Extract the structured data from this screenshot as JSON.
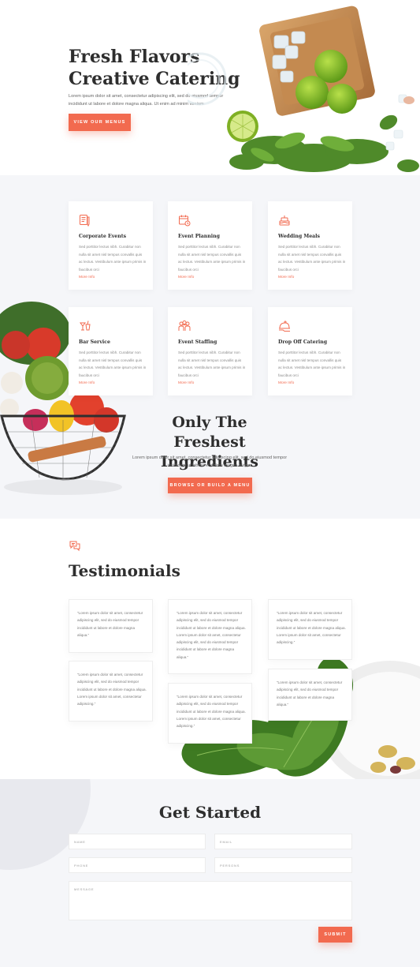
{
  "hero": {
    "title_line1": "Fresh Flavors",
    "title_line2": "Creative Catering",
    "text": "Lorem ipsum dolor sit amet, consectetur adipiscing elit, sed do eiusmod tempor incididunt ut labore et dolore magna aliqua. Ut enim ad minim veniam",
    "button": "VIEW OUR MENUS"
  },
  "services": {
    "items": [
      {
        "icon": "document-pencil-icon",
        "title": "Corporate Events",
        "body": "Sed porttitor lectus nibh. Curabitur non nulla sit amet nisl tempus convallis quis ac lectus. Vestibulum ante ipsum primis in faucibus orci",
        "more": "More Info"
      },
      {
        "icon": "calendar-icon",
        "title": "Event Planning",
        "body": "Sed porttitor lectus nibh. Curabitur non nulla sit amet nisl tempus convallis quis ac lectus. Vestibulum ante ipsum primis in faucibus orci",
        "more": "More Info"
      },
      {
        "icon": "cake-icon",
        "title": "Wedding Meals",
        "body": "Sed porttitor lectus nibh. Curabitur non nulla sit amet nisl tempus convallis quis ac lectus. Vestibulum ante ipsum primis in faucibus orci",
        "more": "More Info"
      },
      {
        "icon": "cocktail-icon",
        "title": "Bar Service",
        "body": "Sed porttitor lectus nibh. Curabitur non nulla sit amet nisl tempus convallis quis ac lectus. Vestibulum ante ipsum primis in faucibus orci",
        "more": "More Info"
      },
      {
        "icon": "staff-icon",
        "title": "Event Staffing",
        "body": "Sed porttitor lectus nibh. Curabitur non nulla sit amet nisl tempus convallis quis ac lectus. Vestibulum ante ipsum primis in faucibus orci",
        "more": "More Info"
      },
      {
        "icon": "cloche-icon",
        "title": "Drop Off Catering",
        "body": "Sed porttitor lectus nibh. Curabitur non nulla sit amet nisl tempus convallis quis ac lectus. Vestibulum ante ipsum primis in faucibus orci",
        "more": "More Info"
      }
    ]
  },
  "fresh": {
    "title_line1": "Only The Freshest",
    "title_line2": "Ingredients",
    "text": "Lorem ipsum dolor sit amet, consectetur adipiscing elit, sed do eiusmod tempor incididunt ut labore et dolore magna aliqua.",
    "button": "BROWSE OR BUILD A MENU"
  },
  "testimonials": {
    "title": "Testimonials",
    "items": [
      "“Lorem ipsum dolor sit amet, consectetur adipiscing elit, sed do eiusmod tempor incididunt ut labore et dolore magna aliqua.”",
      "“Lorem ipsum dolor sit amet, consectetur adipiscing elit, sed do eiusmod tempor incididunt ut labore et dolore magna aliqua. Lorem ipsum dolor sit amet, consectetur adipiscing.”",
      "“Lorem ipsum dolor sit amet, consectetur adipiscing elit, sed do eiusmod tempor incididunt ut labore et dolore magna aliqua. Lorem ipsum dolor sit amet, consectetur adipiscing elit, sed do eiusmod tempor incididunt ut labore et dolore magna aliqua.”",
      "“Lorem ipsum dolor sit amet, consectetur adipiscing elit, sed do eiusmod tempor incididunt ut labore et dolore magna aliqua.”",
      "“Lorem ipsum dolor sit amet, consectetur adipiscing elit, sed do eiusmod tempor incididunt ut labore et dolore magna aliqua. Lorem ipsum dolor sit amet, consectetur adipiscing.”",
      "“Lorem ipsum dolor sit amet, consectetur adipiscing elit, sed do eiusmod tempor incididunt ut labore et dolore magna aliqua. Lorem ipsum dolor sit amet, consectetur adipiscing.”",
      "“Lorem ipsum dolor sit amet, consectetur adipiscing elit, sed do eiusmod tempor incididunt ut labore et dolore magna aliqua.”"
    ]
  },
  "form": {
    "title": "Get Started",
    "name": "NAME",
    "email": "EMAIL",
    "phone": "PHONE",
    "persons": "PERSONS",
    "message": "MESSAGE",
    "submit": "SUBMIT"
  },
  "colors": {
    "accent": "#f26a4f",
    "heading": "#2e2e2e",
    "section_bg": "#f5f6f9"
  }
}
